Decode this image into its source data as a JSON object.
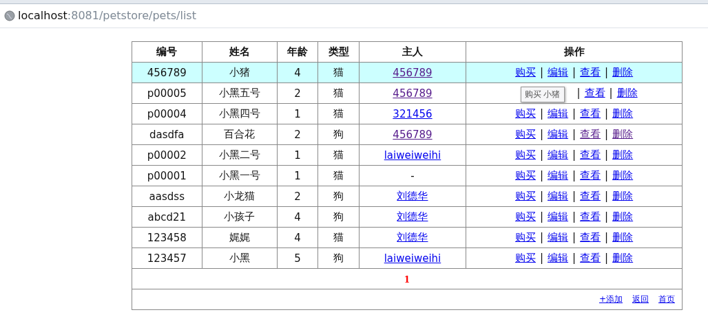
{
  "address_bar": {
    "host": "localhost",
    "path": ":8081/petstore/pets/list"
  },
  "table": {
    "columns": [
      "编号",
      "姓名",
      "年龄",
      "类型",
      "主人",
      "操作"
    ],
    "rows": [
      {
        "selected": true,
        "id": "456789",
        "name": "小猪",
        "age": "4",
        "type": "猫",
        "owner": {
          "kind": "link",
          "text": "456789",
          "visited": true
        },
        "actions": [
          {
            "label": "购买",
            "visited": false
          },
          {
            "label": "编辑",
            "visited": false
          },
          {
            "label": "查看",
            "visited": false
          },
          {
            "label": "删除",
            "visited": false
          }
        ]
      },
      {
        "selected": false,
        "id": "p00005",
        "name": "小黑五号",
        "age": "2",
        "type": "猫",
        "owner": {
          "kind": "link",
          "text": "456789",
          "visited": true
        },
        "tooltip": "购买 小猪",
        "actions": [
          {
            "label": "查看",
            "visited": false
          },
          {
            "label": "删除",
            "visited": false
          }
        ]
      },
      {
        "selected": false,
        "id": "p00004",
        "name": "小黑四号",
        "age": "1",
        "type": "猫",
        "owner": {
          "kind": "link",
          "text": "321456",
          "visited": false
        },
        "actions": [
          {
            "label": "购买",
            "visited": false
          },
          {
            "label": "编辑",
            "visited": false
          },
          {
            "label": "查看",
            "visited": false
          },
          {
            "label": "删除",
            "visited": false
          }
        ]
      },
      {
        "selected": false,
        "id": "dasdfa",
        "name": "百合花",
        "age": "2",
        "type": "狗",
        "owner": {
          "kind": "link",
          "text": "456789",
          "visited": true
        },
        "actions": [
          {
            "label": "购买",
            "visited": false
          },
          {
            "label": "编辑",
            "visited": false
          },
          {
            "label": "查看",
            "visited": true
          },
          {
            "label": "删除",
            "visited": true
          }
        ]
      },
      {
        "selected": false,
        "id": "p00002",
        "name": "小黑二号",
        "age": "1",
        "type": "猫",
        "owner": {
          "kind": "link",
          "text": "laiweiweihi",
          "visited": false
        },
        "actions": [
          {
            "label": "购买",
            "visited": false
          },
          {
            "label": "编辑",
            "visited": false
          },
          {
            "label": "查看",
            "visited": false
          },
          {
            "label": "删除",
            "visited": false
          }
        ]
      },
      {
        "selected": false,
        "id": "p00001",
        "name": "小黑一号",
        "age": "1",
        "type": "猫",
        "owner": {
          "kind": "plain",
          "text": "-"
        },
        "actions": [
          {
            "label": "购买",
            "visited": false
          },
          {
            "label": "编辑",
            "visited": false
          },
          {
            "label": "查看",
            "visited": false
          },
          {
            "label": "删除",
            "visited": false
          }
        ]
      },
      {
        "selected": false,
        "id": "aasdss",
        "name": "小龙猫",
        "age": "2",
        "type": "狗",
        "owner": {
          "kind": "link",
          "text": "刘德华",
          "visited": false
        },
        "actions": [
          {
            "label": "购买",
            "visited": false
          },
          {
            "label": "编辑",
            "visited": false
          },
          {
            "label": "查看",
            "visited": false
          },
          {
            "label": "删除",
            "visited": false
          }
        ]
      },
      {
        "selected": false,
        "id": "abcd21",
        "name": "小孩子",
        "age": "4",
        "type": "狗",
        "owner": {
          "kind": "link",
          "text": "刘德华",
          "visited": false
        },
        "actions": [
          {
            "label": "购买",
            "visited": false
          },
          {
            "label": "编辑",
            "visited": false
          },
          {
            "label": "查看",
            "visited": false
          },
          {
            "label": "删除",
            "visited": false
          }
        ]
      },
      {
        "selected": false,
        "id": "123458",
        "name": "娓娓",
        "age": "4",
        "type": "猫",
        "owner": {
          "kind": "link",
          "text": "刘德华",
          "visited": false
        },
        "actions": [
          {
            "label": "购买",
            "visited": false
          },
          {
            "label": "编辑",
            "visited": false
          },
          {
            "label": "查看",
            "visited": false
          },
          {
            "label": "删除",
            "visited": false
          }
        ]
      },
      {
        "selected": false,
        "id": "123457",
        "name": "小黑",
        "age": "5",
        "type": "狗",
        "owner": {
          "kind": "link",
          "text": "laiweiweihi",
          "visited": false
        },
        "actions": [
          {
            "label": "购买",
            "visited": false
          },
          {
            "label": "编辑",
            "visited": false
          },
          {
            "label": "查看",
            "visited": false
          },
          {
            "label": "删除",
            "visited": false
          }
        ]
      }
    ],
    "separator": "|",
    "pagination": [
      {
        "label": "1",
        "selected": true
      }
    ],
    "footer_links": [
      "+添加",
      "返回",
      "首页"
    ]
  }
}
